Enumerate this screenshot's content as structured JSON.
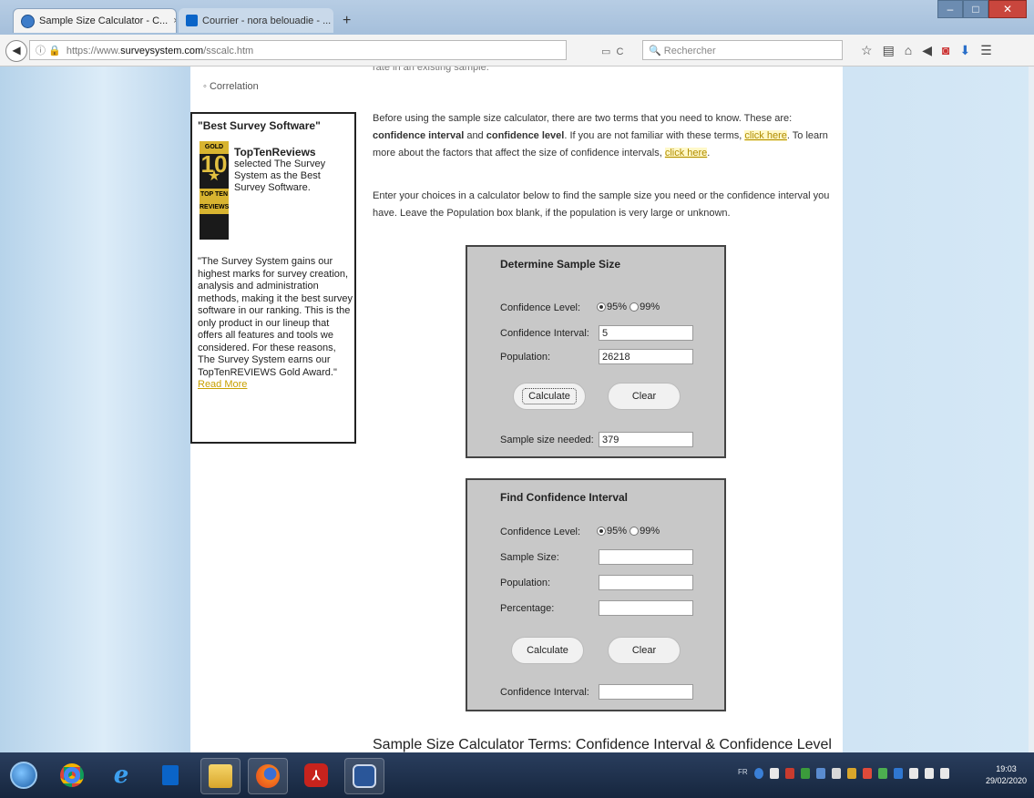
{
  "browser": {
    "tabs": [
      {
        "title": "Sample Size Calculator - C...",
        "close": "×",
        "active": true
      },
      {
        "title": "Courrier - nora belouadie - ...",
        "close": "×",
        "active": false
      }
    ],
    "new_tab": "+",
    "window_controls": {
      "minimize": "–",
      "maximize": "□",
      "close": "✕"
    },
    "url": {
      "prefix": "https://www.",
      "domain": "surveysystem.com",
      "path": "/sscalc.htm"
    },
    "reload": "C",
    "search_placeholder": "Rechercher",
    "toolbar_icons": [
      "star-icon",
      "reading-list-icon",
      "home-icon",
      "send-icon",
      "pocket-icon",
      "download-icon",
      "menu-icon"
    ]
  },
  "sidebar": {
    "link": "Correlation",
    "award": {
      "title": "\"Best Survey Software\"",
      "badge_top": "GOLD",
      "badge_number": "10",
      "badge_bottom": "TOP TEN REVIEWS",
      "brand": "TopTenReviews",
      "blurb": "selected The Survey System as the Best Survey Software.",
      "quote": "\"The Survey System gains our highest marks for survey creation, analysis and administration methods, making it the best survey software in our ranking. This is the only product in our lineup that offers all features and tools we considered. For these reasons, The Survey System earns our TopTenREVIEWS Gold Award.\"",
      "read_more": "Read More"
    }
  },
  "main": {
    "cut_line": "rate in an existing sample.",
    "para1": {
      "a": "Before using the sample size calculator, there are two terms that you need to know. These are: ",
      "b": "confidence interval",
      "c": " and ",
      "d": "confidence level",
      "e": ". If you are not familiar with these terms, ",
      "link1": "click here",
      "f": ". To learn more about the factors that affect the size of confidence intervals, ",
      "link2": "click here",
      "g": "."
    },
    "para2": "Enter your choices in a calculator below to find the sample size you need or the confidence interval you have. Leave the Population box blank, if the population is very large or unknown.",
    "sample_calc": {
      "title": "Determine Sample Size",
      "conf_level_label": "Confidence Level:",
      "opt95": "95%",
      "opt99": "99%",
      "selected": "95%",
      "conf_interval_label": "Confidence Interval:",
      "conf_interval_value": "5",
      "population_label": "Population:",
      "population_value": "26218",
      "calculate": "Calculate",
      "clear": "Clear",
      "result_label": "Sample size needed:",
      "result_value": "379"
    },
    "ci_calc": {
      "title": "Find Confidence Interval",
      "conf_level_label": "Confidence Level:",
      "opt95": "95%",
      "opt99": "99%",
      "selected": "95%",
      "sample_size_label": "Sample Size:",
      "sample_size_value": "",
      "population_label": "Population:",
      "population_value": "",
      "percentage_label": "Percentage:",
      "percentage_value": "",
      "calculate": "Calculate",
      "clear": "Clear",
      "result_label": "Confidence Interval:",
      "result_value": ""
    },
    "section_heading": "Sample Size Calculator Terms: Confidence Interval & Confidence Level"
  },
  "taskbar": {
    "apps": [
      "start-orb",
      "chrome-icon",
      "internet-explorer-icon",
      "outlook-icon",
      "file-explorer-icon",
      "firefox-icon",
      "acrobat-icon",
      "word-icon"
    ],
    "clock_time": "19:03",
    "clock_date": "29/02/2020",
    "language": "FR"
  }
}
